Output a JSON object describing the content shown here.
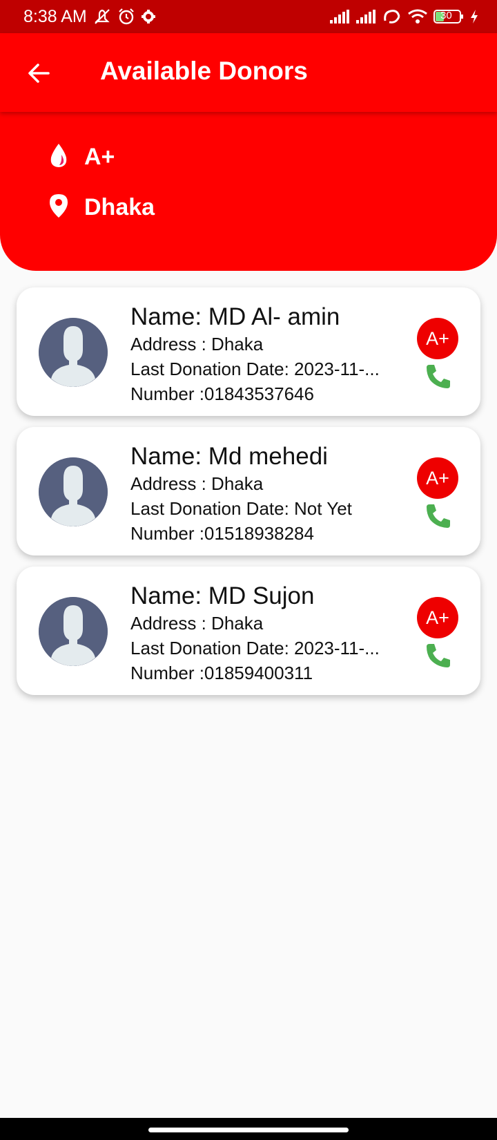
{
  "status_bar": {
    "time": "8:38 AM",
    "battery": "30",
    "icons": [
      "mute-icon",
      "alarm-icon",
      "gear-icon",
      "signal-icon",
      "signal-icon",
      "sync-icon",
      "wifi-icon",
      "battery-icon",
      "charging-icon"
    ]
  },
  "app_bar": {
    "title": "Available Donors",
    "back_icon": "arrow-back-icon"
  },
  "filter": {
    "blood_group": "A+",
    "location": "Dhaka"
  },
  "donors": [
    {
      "name": "Name: MD Al- amin",
      "address": "Address : Dhaka",
      "last_donation": "Last Donation Date: 2023-11-...",
      "number": "Number :01843537646",
      "blood_group": "A+"
    },
    {
      "name": "Name: Md mehedi",
      "address": "Address : Dhaka",
      "last_donation": "Last Donation Date: Not Yet",
      "number": "Number :01518938284",
      "blood_group": "A+"
    },
    {
      "name": "Name: MD Sujon",
      "address": "Address : Dhaka",
      "last_donation": "Last Donation Date: 2023-11-...",
      "number": "Number :01859400311",
      "blood_group": "A+"
    }
  ],
  "colors": {
    "primary": "#ff0000",
    "status_bar": "#bf0000",
    "badge": "#ee0000",
    "call": "#4caf50",
    "avatar": "#56607f",
    "background": "#fafafa"
  }
}
